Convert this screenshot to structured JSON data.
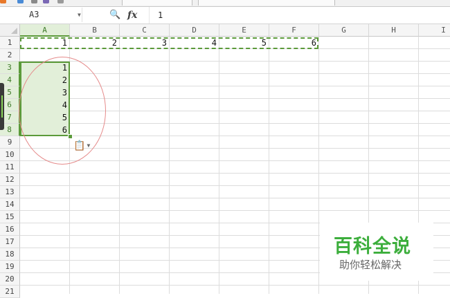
{
  "name_box": {
    "value": "A3"
  },
  "formula_bar": {
    "fx_label": "fx",
    "value": "1"
  },
  "columns": [
    "A",
    "B",
    "C",
    "D",
    "E",
    "F",
    "G",
    "H",
    "I"
  ],
  "rows": [
    "1",
    "2",
    "3",
    "4",
    "5",
    "6",
    "7",
    "8",
    "9",
    "10",
    "11",
    "12",
    "13",
    "14",
    "15",
    "16",
    "17",
    "18",
    "19",
    "20",
    "21"
  ],
  "row1_values": [
    "1",
    "2",
    "3",
    "4",
    "5",
    "6"
  ],
  "col_a_values": [
    "1",
    "2",
    "3",
    "4",
    "5",
    "6"
  ],
  "watermark": {
    "title": "百科全说",
    "subtitle": "助你轻松解决"
  },
  "colors": {
    "selection": "#5b9a3a",
    "selection_fill": "#e2efd9",
    "annotation": "#e58a8a",
    "watermark_green": "#3cae3c"
  }
}
